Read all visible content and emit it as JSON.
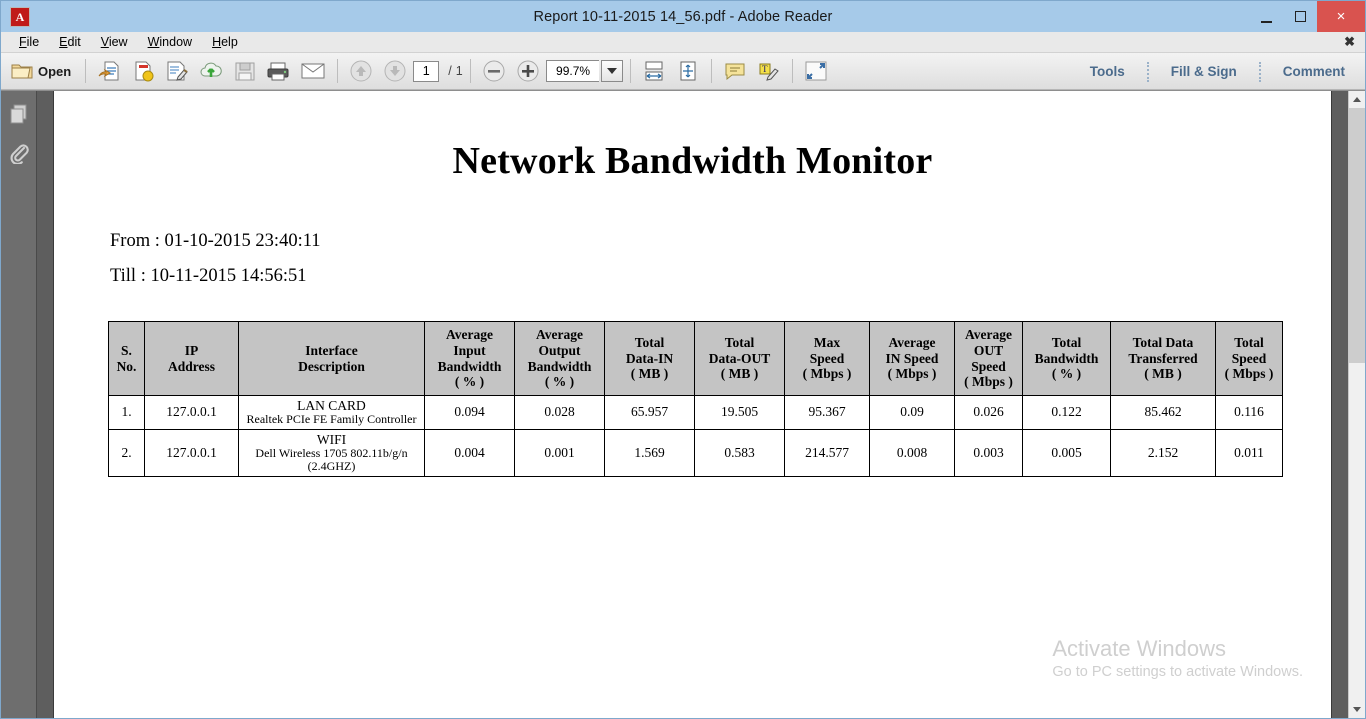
{
  "window": {
    "title": "Report 10-11-2015 14_56.pdf - Adobe Reader",
    "app_icon": "adobe-reader-icon",
    "minimize": "minimize-icon",
    "maximize": "maximize-icon",
    "close": "×"
  },
  "menubar": {
    "items": [
      {
        "label": "File",
        "accel": "F"
      },
      {
        "label": "Edit",
        "accel": "E"
      },
      {
        "label": "View",
        "accel": "V"
      },
      {
        "label": "Window",
        "accel": "W"
      },
      {
        "label": "Help",
        "accel": "H"
      }
    ],
    "close_label": "✖"
  },
  "toolbar": {
    "open_label": "Open",
    "open_icon": "folder-open-icon",
    "icons": [
      "create-pdf-icon",
      "export-pdf-icon",
      "edit-pdf-icon",
      "send-to-cloud-icon",
      "save-icon",
      "print-icon",
      "email-icon"
    ],
    "prev_page_icon": "previous-page-icon",
    "next_page_icon": "next-page-icon",
    "page_number": "1",
    "page_total": "/ 1",
    "zoom_out_icon": "zoom-out-icon",
    "zoom_in_icon": "zoom-in-icon",
    "zoom_value": "99.7%",
    "zoom_dropdown_icon": "chevron-down-icon",
    "fit_width_icon": "fit-width-icon",
    "fit_page_icon": "fit-page-icon",
    "comment_icon": "sticky-note-icon",
    "highlight_text_icon": "highlight-text-icon",
    "read_mode_icon": "read-mode-icon",
    "right_links": [
      "Tools",
      "Fill & Sign",
      "Comment"
    ],
    "accent_color": "#4b6b8c"
  },
  "navpanel": {
    "page_thumbnails_icon": "page-thumbnails-icon",
    "attachments_icon": "paperclip-icon"
  },
  "document": {
    "title": "Network Bandwidth Monitor",
    "from_line": "From : 01-10-2015 23:40:11",
    "till_line": "Till : 10-11-2015 14:56:51",
    "table": {
      "headers": [
        "S.\nNo.",
        "IP\nAddress",
        "Interface\nDescription",
        "Average\nInput\nBandwidth\n( % )",
        "Average\nOutput\nBandwidth\n( % )",
        "Total\nData-IN\n( MB )",
        "Total\nData-OUT\n( MB )",
        "Max\nSpeed\n( Mbps )",
        "Average\nIN Speed\n( Mbps )",
        "Average\nOUT\nSpeed\n( Mbps )",
        "Total\nBandwidth\n( % )",
        "Total Data\nTransferred\n( MB )",
        "Total\nSpeed\n( Mbps )"
      ],
      "rows": [
        {
          "sno": "1.",
          "ip": "127.0.0.1",
          "iface_name": "LAN CARD",
          "iface_desc": "Realtek PCIe FE Family Controller",
          "avg_input_bw": "0.094",
          "avg_output_bw": "0.028",
          "total_data_in": "65.957",
          "total_data_out": "19.505",
          "max_speed": "95.367",
          "avg_in_speed": "0.09",
          "avg_out_speed": "0.026",
          "total_bandwidth": "0.122",
          "total_data_transferred": "85.462",
          "total_speed": "0.116"
        },
        {
          "sno": "2.",
          "ip": "127.0.0.1",
          "iface_name": "WIFI",
          "iface_desc": "Dell Wireless 1705 802.11b/g/n\n(2.4GHZ)",
          "avg_input_bw": "0.004",
          "avg_output_bw": "0.001",
          "total_data_in": "1.569",
          "total_data_out": "0.583",
          "max_speed": "214.577",
          "avg_in_speed": "0.008",
          "avg_out_speed": "0.003",
          "total_bandwidth": "0.005",
          "total_data_transferred": "2.152",
          "total_speed": "0.011"
        }
      ]
    }
  },
  "watermark": {
    "line1": "Activate Windows",
    "line2": "Go to PC settings to activate Windows.",
    "color": "#cfcfcf"
  },
  "scrollbar": {
    "up_icon": "chevron-up-icon",
    "down_icon": "chevron-down-icon"
  }
}
